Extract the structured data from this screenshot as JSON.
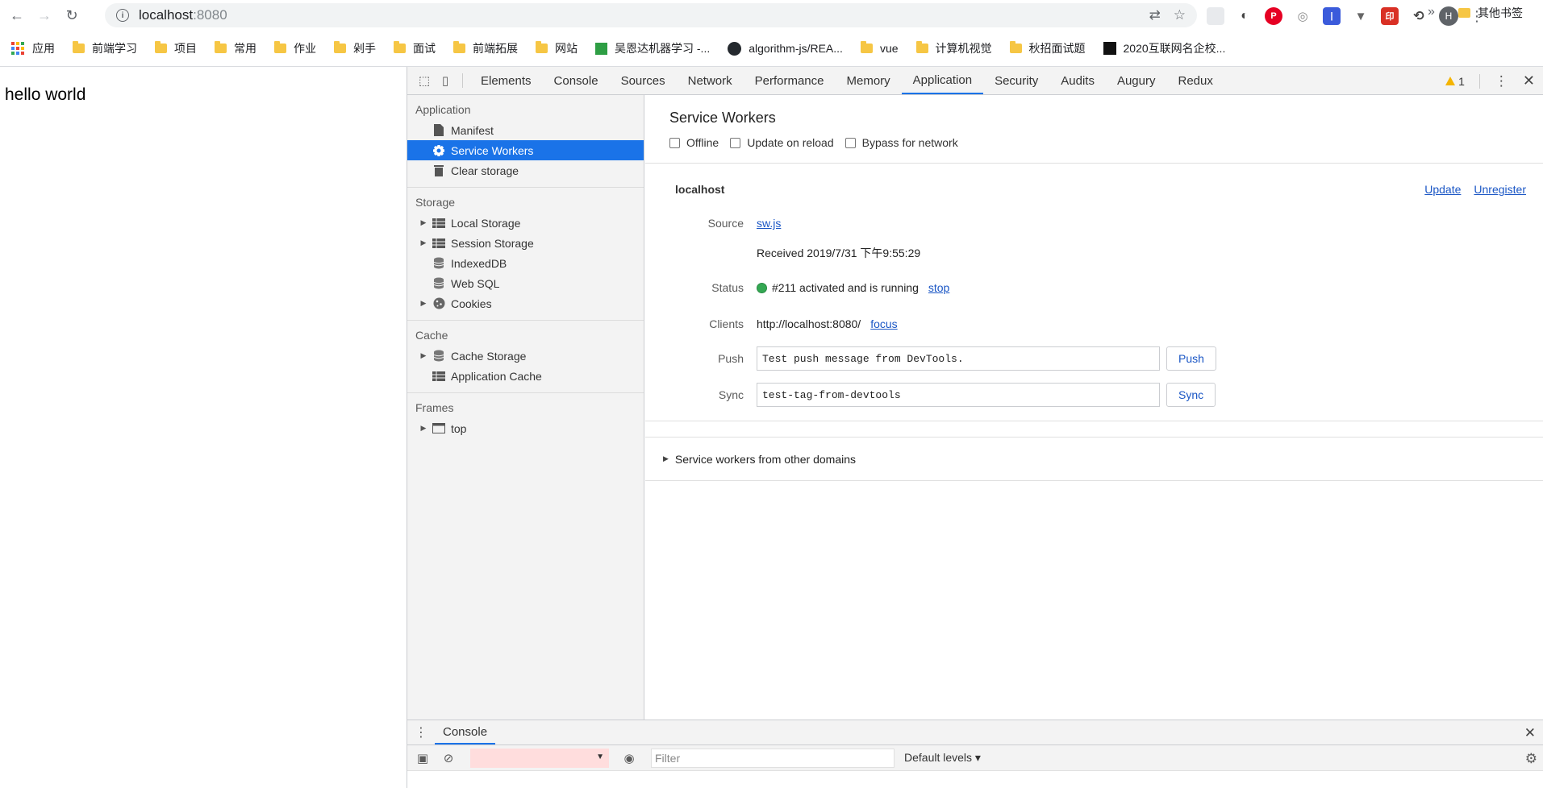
{
  "browser": {
    "url_host": "localhost",
    "url_port": ":8080",
    "avatar_letter": "H",
    "bookmarks_apps": "应用",
    "bookmarks": [
      "前端学习",
      "项目",
      "常用",
      "作业",
      "剁手",
      "面试",
      "前端拓展",
      "网站"
    ],
    "bookmark_ml": "吴恩达机器学习 -...",
    "bookmark_github": "algorithm-js/REA...",
    "bookmarks_more": [
      "vue",
      "计算机视觉",
      "秋招面试题"
    ],
    "bookmark_2020": "2020互联网名企校...",
    "bookmark_overflow": "»",
    "bookmark_other": "其他书签"
  },
  "page": {
    "body_text": "hello world"
  },
  "devtools": {
    "tabs": [
      "Elements",
      "Console",
      "Sources",
      "Network",
      "Performance",
      "Memory",
      "Application",
      "Security",
      "Audits",
      "Augury",
      "Redux"
    ],
    "active_tab": "Application",
    "warning_count": "1",
    "sidebar": {
      "application_head": "Application",
      "application_items": [
        "Manifest",
        "Service Workers",
        "Clear storage"
      ],
      "storage_head": "Storage",
      "storage_items": [
        "Local Storage",
        "Session Storage",
        "IndexedDB",
        "Web SQL",
        "Cookies"
      ],
      "cache_head": "Cache",
      "cache_items": [
        "Cache Storage",
        "Application Cache"
      ],
      "frames_head": "Frames",
      "frames_items": [
        "top"
      ]
    },
    "service_workers": {
      "title": "Service Workers",
      "options": [
        "Offline",
        "Update on reload",
        "Bypass for network"
      ],
      "origin": "localhost",
      "update_label": "Update",
      "unregister_label": "Unregister",
      "source_label": "Source",
      "source_file": "sw.js",
      "received": "Received 2019/7/31 下午9:55:29",
      "status_label": "Status",
      "status_text": "#211 activated and is running",
      "stop_label": "stop",
      "clients_label": "Clients",
      "clients_url": "http://localhost:8080/",
      "focus_label": "focus",
      "push_label": "Push",
      "push_value": "Test push message from DevTools.",
      "push_button": "Push",
      "sync_label": "Sync",
      "sync_value": "test-tag-from-devtools",
      "sync_button": "Sync",
      "other_domains": "Service workers from other domains"
    },
    "drawer": {
      "tab": "Console",
      "filter_placeholder": "Filter",
      "levels": "Default levels ▾"
    }
  },
  "colors": {
    "accent": "#1a73e8",
    "link": "#1a56c5",
    "status_green": "#34a853",
    "warning": "#f4b400"
  }
}
